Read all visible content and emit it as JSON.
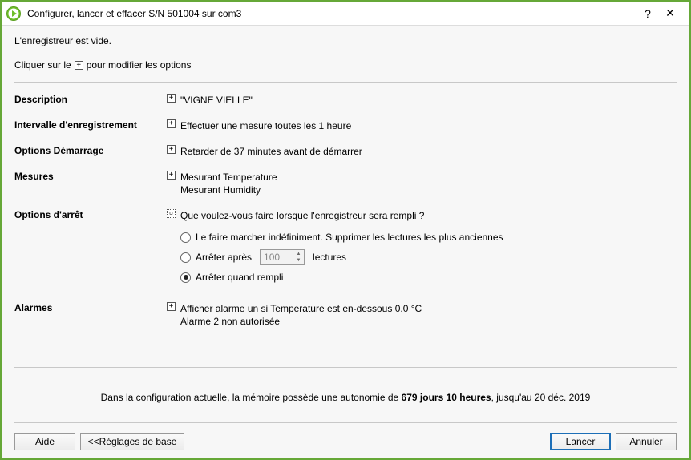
{
  "window": {
    "title": "Configurer, lancer et effacer S/N 501004 sur com3"
  },
  "status": "L'enregistreur est vide.",
  "instruction": {
    "prefix": "Cliquer sur le",
    "suffix": "pour modifier les options"
  },
  "rows": {
    "description": {
      "label": "Description",
      "value": "\"VIGNE VIELLE\""
    },
    "interval": {
      "label": "Intervalle d'enregistrement",
      "value": "Effectuer une mesure toutes les 1 heure"
    },
    "start": {
      "label": "Options Démarrage",
      "value": "Retarder de 37 minutes avant de démarrer"
    },
    "measures": {
      "label": "Mesures",
      "line1": "Mesurant Temperature",
      "line2": "Mesurant Humidity"
    },
    "stop": {
      "label": "Options d'arrêt",
      "question": "Que voulez-vous faire lorsque l'enregistreur sera rempli ?",
      "opt1": "Le faire marcher indéfiniment. Supprimer les lectures les plus anciennes",
      "opt2_prefix": "Arrêter après",
      "opt2_count": "100",
      "opt2_suffix": "lectures",
      "opt3": "Arrêter quand rempli"
    },
    "alarms": {
      "label": "Alarmes",
      "line1": "Afficher alarme un si Temperature est en-dessous 0.0 °C",
      "line2": "Alarme 2 non autorisée"
    }
  },
  "footer": {
    "prefix": "Dans la configuration actuelle, la mémoire possède une autonomie de ",
    "bold": "679 jours 10 heures",
    "suffix": ", jusqu'au 20 déc. 2019"
  },
  "buttons": {
    "help": "Aide",
    "presets": "<<Réglages de base",
    "launch": "Lancer",
    "cancel": "Annuler"
  }
}
